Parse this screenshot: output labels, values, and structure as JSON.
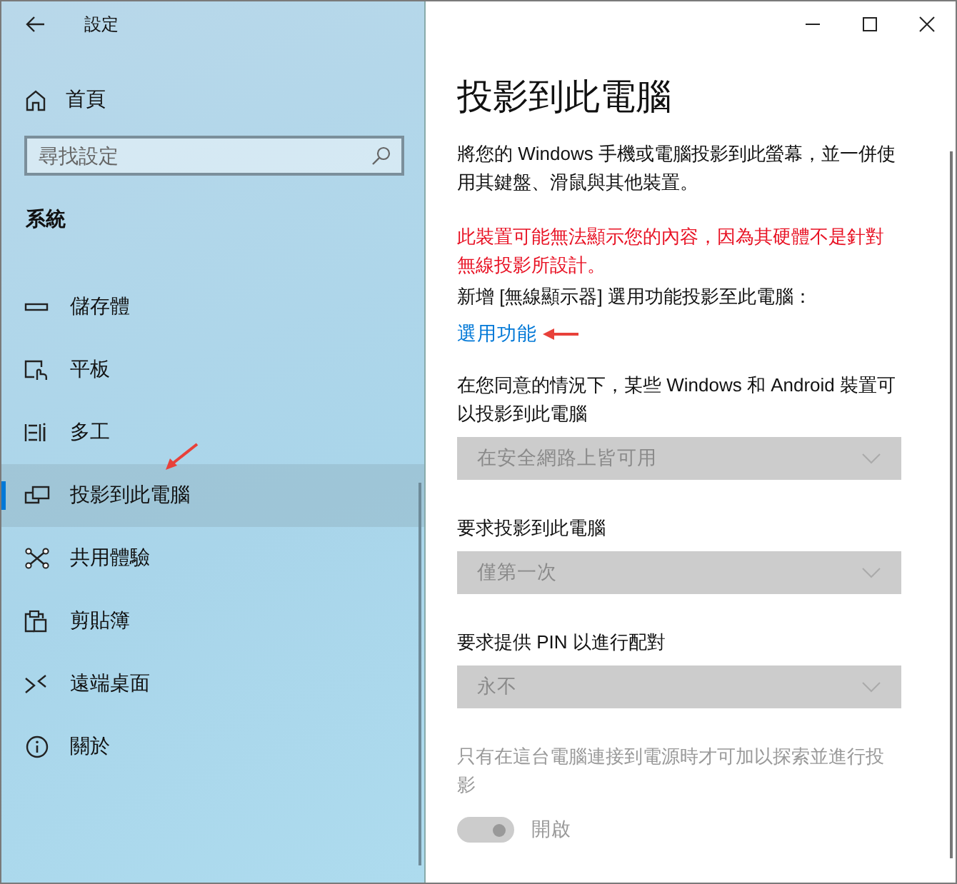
{
  "window": {
    "title": "設定"
  },
  "sidebar": {
    "home": "首頁",
    "search": {
      "placeholder": "尋找設定"
    },
    "section": "系統",
    "items": [
      {
        "label": "儲存體",
        "kind": "storage",
        "selected": false
      },
      {
        "label": "平板",
        "kind": "tablet",
        "selected": false
      },
      {
        "label": "多工",
        "kind": "multitask",
        "selected": false
      },
      {
        "label": "投影到此電腦",
        "kind": "project",
        "selected": true
      },
      {
        "label": "共用體驗",
        "kind": "shared",
        "selected": false
      },
      {
        "label": "剪貼簿",
        "kind": "clipboard",
        "selected": false
      },
      {
        "label": "遠端桌面",
        "kind": "remote",
        "selected": false
      },
      {
        "label": "關於",
        "kind": "about",
        "selected": false
      }
    ]
  },
  "main": {
    "title": "投影到此電腦",
    "description": "將您的 Windows 手機或電腦投影到此螢幕，並一併使用其鍵盤、滑鼠與其他裝置。",
    "warning": "此裝置可能無法顯示您的內容，因為其硬體不是針對無線投影所設計。",
    "note": "新增 [無線顯示器] 選用功能投影至此電腦：",
    "link": "選用功能",
    "settings": [
      {
        "label": "在您同意的情況下，某些 Windows 和 Android 裝置可以投影到此電腦",
        "value": "在安全網路上皆可用",
        "disabled": true
      },
      {
        "label": "要求投影到此電腦",
        "value": "僅第一次",
        "disabled": true
      },
      {
        "label": "要求提供 PIN 以進行配對",
        "value": "永不",
        "disabled": true
      }
    ],
    "power_toggle": {
      "label": "只有在這台電腦連接到電源時才可加以探索並進行投影",
      "on": true,
      "state_text": "開啟",
      "disabled": true
    }
  }
}
